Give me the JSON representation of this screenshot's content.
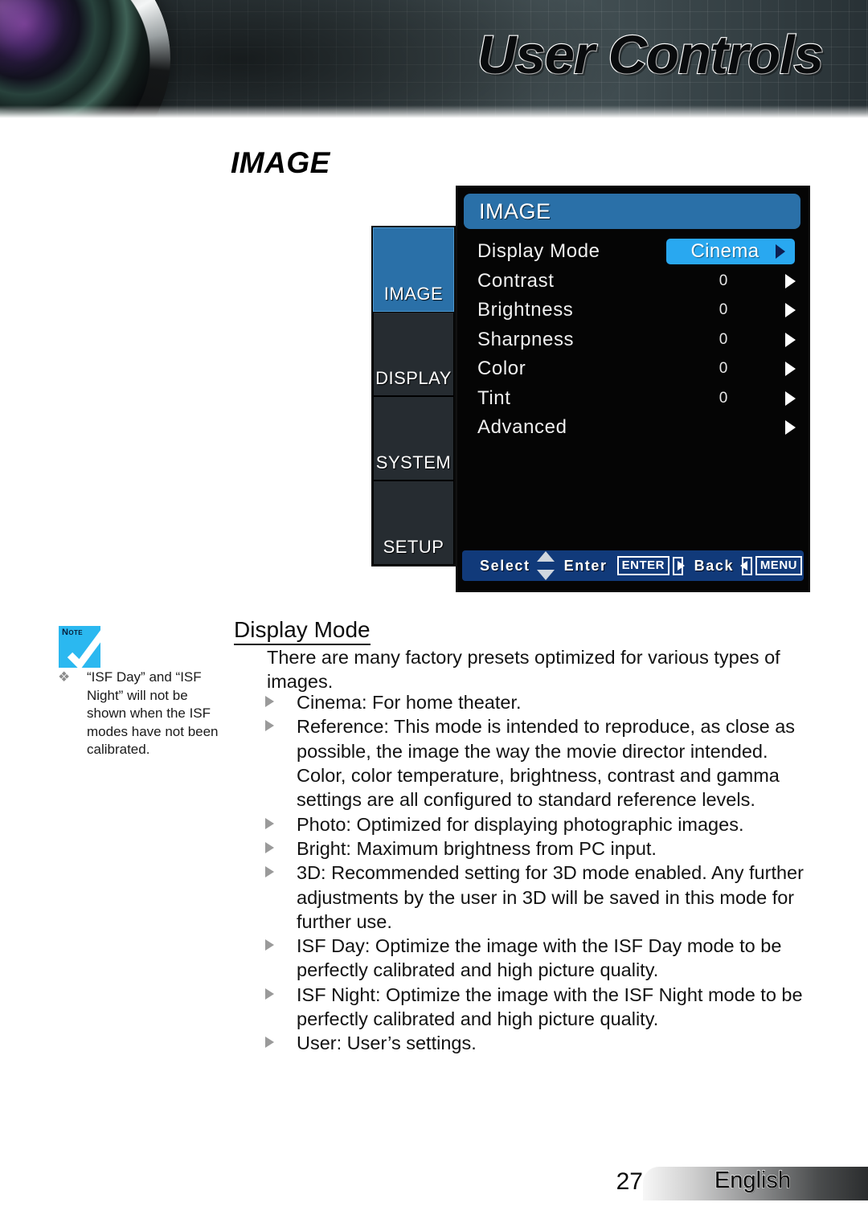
{
  "header": {
    "title": "User Controls",
    "lens_icon": "projector-lens-image"
  },
  "page": {
    "heading": "IMAGE",
    "number": "27",
    "language": "English"
  },
  "osd": {
    "title": "IMAGE",
    "tabs": [
      {
        "label": "IMAGE",
        "active": true
      },
      {
        "label": "DISPLAY",
        "active": false
      },
      {
        "label": "SYSTEM",
        "active": false
      },
      {
        "label": "SETUP",
        "active": false
      }
    ],
    "rows": [
      {
        "label": "Display Mode",
        "value": "Cinema",
        "highlight": true
      },
      {
        "label": "Contrast",
        "value": "0",
        "highlight": false
      },
      {
        "label": "Brightness",
        "value": "0",
        "highlight": false
      },
      {
        "label": "Sharpness",
        "value": "0",
        "highlight": false
      },
      {
        "label": "Color",
        "value": "0",
        "highlight": false
      },
      {
        "label": "Tint",
        "value": "0",
        "highlight": false
      },
      {
        "label": "Advanced",
        "value": "",
        "highlight": false
      }
    ],
    "bottom_bar": {
      "select_label": "Select",
      "enter_label": "Enter",
      "enter_key": "ENTER",
      "back_label": "Back",
      "back_key": "MENU"
    },
    "colors": {
      "title_bar": "#2a70a8",
      "active_tab": "#2a70a8",
      "highlight_chip": "#29a8f0",
      "bottom_bar": "#113a7a",
      "panel_bg": "#050505",
      "tab_bg": "#262c31"
    }
  },
  "note": {
    "icon_label": "Note",
    "bullet": "❖",
    "text": "“ISF Day” and “ISF Night” will not be shown when the ISF modes have not been calibrated."
  },
  "content": {
    "section_title": "Display Mode",
    "intro": "There are many factory presets optimized for various types of images.",
    "bullets": [
      "Cinema: For home theater.",
      "Reference: This mode is intended to reproduce, as close as possible, the image the way the movie director intended. Color, color temperature, brightness, contrast and gamma settings are all configured to standard reference levels.",
      "Photo: Optimized for displaying photographic images.",
      "Bright: Maximum brightness from PC input.",
      "3D: Recommended setting for 3D mode enabled. Any further adjustments by the user in 3D will be saved in this mode for further use.",
      "ISF Day: Optimize the image with the ISF Day mode to be perfectly calibrated and high picture quality.",
      "ISF Night: Optimize the image with the ISF Night mode to be perfectly calibrated and high picture quality.",
      "User: User’s settings."
    ]
  }
}
